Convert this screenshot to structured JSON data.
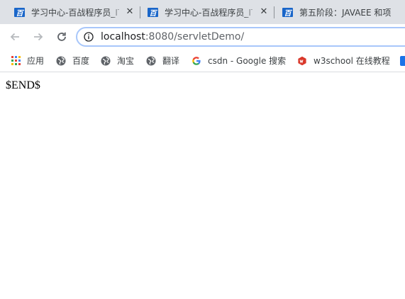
{
  "tabs": [
    {
      "title": "学习中心-百战程序员_IT",
      "close": "✕"
    },
    {
      "title": "学习中心-百战程序员_IT",
      "close": "✕"
    },
    {
      "title": "第五阶段：JAVAEE 和项",
      "close": "✕"
    }
  ],
  "tab_favicon_glyph": "百",
  "toolbar": {
    "back_icon": "arrow-left-icon",
    "forward_icon": "arrow-right-icon",
    "reload_icon": "reload-icon",
    "url_host": "localhost",
    "url_rest": ":8080/servletDemo/"
  },
  "bookmarks": [
    {
      "label": "应用",
      "icon": "apps-grid-icon"
    },
    {
      "label": "百度",
      "icon": "globe-icon"
    },
    {
      "label": "淘宝",
      "icon": "globe-icon"
    },
    {
      "label": "翻译",
      "icon": "globe-icon"
    },
    {
      "label": "csdn - Google 搜索",
      "icon": "google-icon"
    },
    {
      "label": "w3school 在线教程",
      "icon": "w3school-icon"
    }
  ],
  "page": {
    "text": "$END$"
  },
  "colors": {
    "tab_strip": "#dee1e6",
    "favicon_blue": "#1a66c9",
    "omnibox_border": "#a8c7fa",
    "w3school_red": "#d9372a"
  }
}
